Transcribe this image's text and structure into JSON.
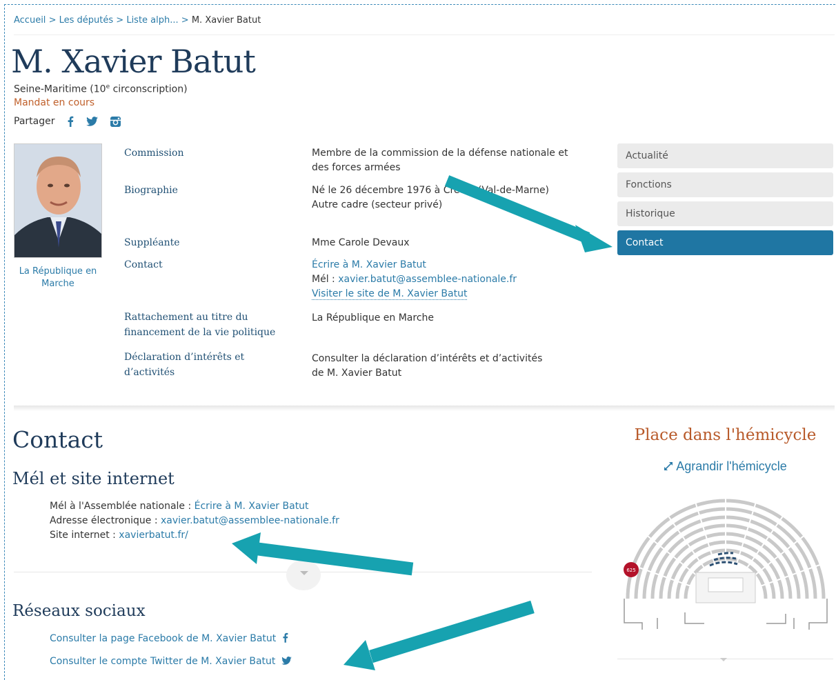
{
  "breadcrumb": {
    "items": [
      "Accueil",
      "Les députés",
      "Liste alph..."
    ],
    "separator": ">",
    "current": "M. Xavier Batut"
  },
  "header": {
    "name": "M. Xavier Batut",
    "circonscription_prefix": "Seine-Maritime (10",
    "circonscription_sup": "e",
    "circonscription_suffix": " circonscription)",
    "mandat": "Mandat en cours",
    "partager": "Partager"
  },
  "party": "La République en Marche",
  "info": {
    "commission_label": "Commission",
    "commission_value": "Membre de la commission de la défense nationale et des forces armées",
    "biographie_label": "Biographie",
    "biographie_line1": "Né le 26 décembre 1976 à Créteil (Val-de-Marne)",
    "biographie_line2": "Autre cadre (secteur privé)",
    "suppleante_label": "Suppléante",
    "suppleante_value": "Mme Carole Devaux",
    "contact_label": "Contact",
    "contact_ecrire": "Écrire à M. Xavier Batut",
    "contact_mel_prefix": "Mél : ",
    "contact_mel": "xavier.batut@assemblee-nationale.fr",
    "contact_site": "Visiter le site de M. Xavier Batut",
    "rattachement_label": "Rattachement au titre du financement de la vie politique",
    "rattachement_value": "La République en Marche",
    "declaration_label": "Déclaration d’intérêts et d’activités",
    "declaration_value": "Consulter la déclaration d’intérêts et d’activités de M. Xavier Batut"
  },
  "side_menu": [
    "Actualité",
    "Fonctions",
    "Historique",
    "Contact"
  ],
  "contact_section": {
    "title": "Contact",
    "mel_title": "Mél et site internet",
    "mel_an_label": "Mél à l'Assemblée nationale : ",
    "mel_an_link": "Écrire à M. Xavier Batut",
    "adresse_label": "Adresse électronique : ",
    "adresse_link": "xavier.batut@assemblee-nationale.fr",
    "site_label": "Site internet : ",
    "site_link": "xavierbatut.fr/",
    "reseaux_title": "Réseaux sociaux",
    "facebook": "Consulter la page Facebook de M. Xavier Batut",
    "twitter": "Consulter le compte Twitter de M. Xavier Batut"
  },
  "hemicycle": {
    "title": "Place dans l'hémicycle",
    "agrandir": "Agrandir l'hémicycle",
    "seat_number": "625"
  },
  "colors": {
    "link": "#2b7ba8",
    "heading": "#1f3b5a",
    "accent_orange": "#c0602b",
    "menu_active": "#1f76a3",
    "annotation_arrow": "#17a2b0"
  }
}
